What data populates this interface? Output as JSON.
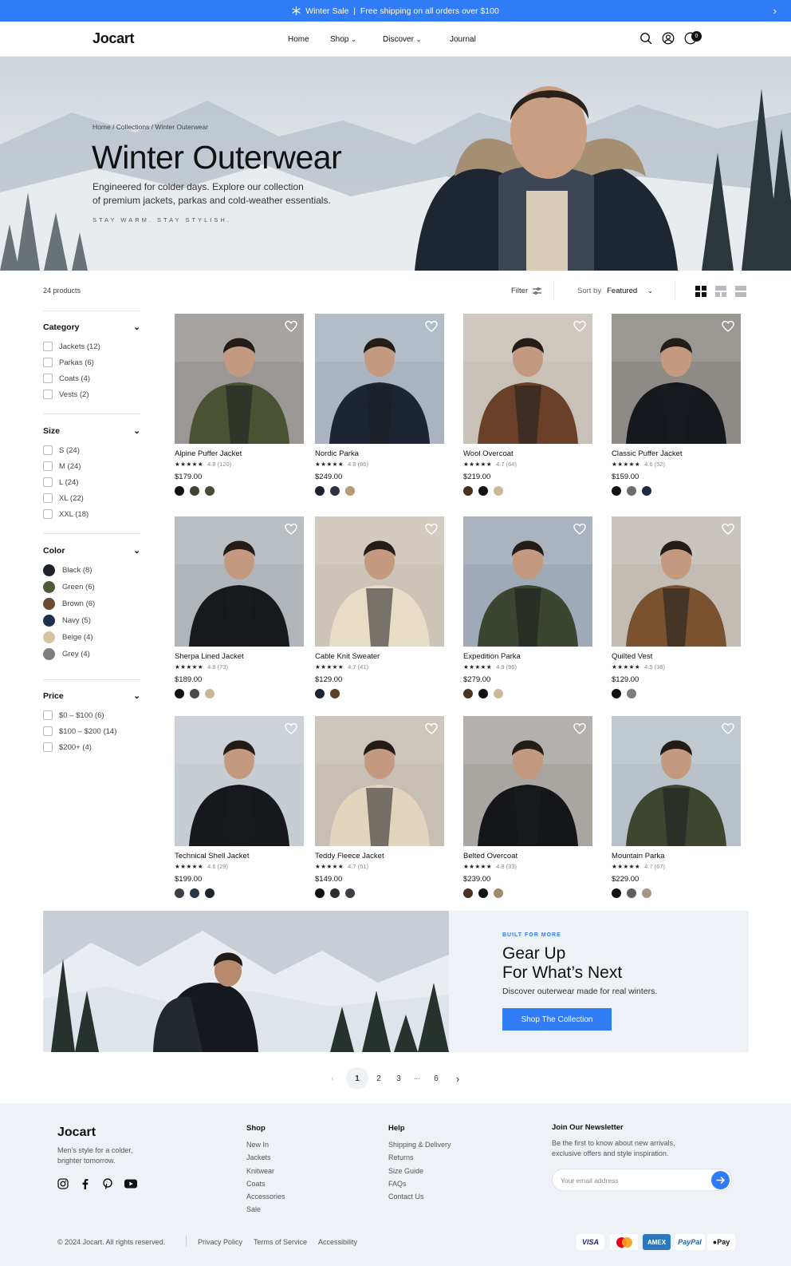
{
  "announcement": {
    "text": "Winter Sale  |  Free shipping on all orders over $100",
    "snow_icon": "snowflake-icon",
    "next_icon": "chevron-right-icon"
  },
  "header": {
    "logo": "Jocart",
    "nav": [
      {
        "label": "Home"
      },
      {
        "label": "Shop"
      },
      {
        "label": "Discover"
      },
      {
        "label": "Journal"
      }
    ],
    "cart_count": "0"
  },
  "hero": {
    "breadcrumb": [
      "Home",
      "Collections",
      "Winter Outerwear"
    ],
    "title": "Winter Outerwear",
    "description_1": "Engineered for colder days. Explore our collection",
    "description_2": "of premium jackets, parkas and cold-weather essentials.",
    "tagline": "STAY WARM. STAY STYLISH."
  },
  "toolbar": {
    "count": "24 products",
    "filter_label": "Filter",
    "sort_label": "Sort by",
    "sort_value": "Featured"
  },
  "filters": {
    "category": {
      "title": "Category",
      "options": [
        "Jackets (12)",
        "Parkas (6)",
        "Coats (4)",
        "Vests (2)"
      ]
    },
    "size": {
      "title": "Size",
      "options": [
        "S (24)",
        "M (24)",
        "L (24)",
        "XL (22)",
        "XXL (18)"
      ]
    },
    "color": {
      "title": "Color",
      "options": [
        {
          "label": "Black (8)",
          "hex": "#1e2329"
        },
        {
          "label": "Green (6)",
          "hex": "#4d5a3a"
        },
        {
          "label": "Brown (6)",
          "hex": "#6b4a30"
        },
        {
          "label": "Navy (5)",
          "hex": "#1f2f4e"
        },
        {
          "label": "Beige (4)",
          "hex": "#d7c3a2"
        },
        {
          "label": "Grey (4)",
          "hex": "#7b7d80"
        }
      ]
    },
    "price": {
      "title": "Price",
      "options": [
        "$0 – $100 (6)",
        "$100 – $200 (14)",
        "$200+ (4)"
      ]
    }
  },
  "products": [
    {
      "name": "Alpine Puffer Jacket",
      "rating": "4.8 (120)",
      "price": "$179.00",
      "jacket": "#4a5234",
      "bg": "#9a9795",
      "colors": [
        "#111",
        "#3e4530",
        "#4a4d30"
      ]
    },
    {
      "name": "Nordic Parka",
      "rating": "4.9 (86)",
      "price": "$249.00",
      "jacket": "#1d2532",
      "bg": "#a9b4c0",
      "colors": [
        "#1a2232",
        "#2b3342",
        "#b89a73"
      ]
    },
    {
      "name": "Wool Overcoat",
      "rating": "4.7 (64)",
      "price": "$219.00",
      "jacket": "#6a4128",
      "bg": "#c8c1b8",
      "colors": [
        "#4a3020",
        "#111",
        "#c8b89c"
      ]
    },
    {
      "name": "Classic Puffer Jacket",
      "rating": "4.6 (52)",
      "price": "$159.00",
      "jacket": "#15181d",
      "bg": "#8e8a85",
      "colors": [
        "#111",
        "#6c6c6c",
        "#1c2b45"
      ]
    },
    {
      "name": "Sherpa Lined Jacket",
      "rating": "4.8 (73)",
      "price": "$189.00",
      "jacket": "#17191c",
      "bg": "#b0b5ba",
      "colors": [
        "#111",
        "#4a4a4a",
        "#c8b59a"
      ]
    },
    {
      "name": "Cable Knit Sweater",
      "rating": "4.7 (41)",
      "price": "$129.00",
      "jacket": "#e7dcc5",
      "bg": "#cdc4b8",
      "colors": [
        "#1c2333",
        "#5a4028"
      ]
    },
    {
      "name": "Expedition Parka",
      "rating": "4.9 (96)",
      "price": "$279.00",
      "jacket": "#3b4530",
      "bg": "#9eaab7",
      "colors": [
        "#4a3322",
        "#111",
        "#c8b89c"
      ]
    },
    {
      "name": "Quilted Vest",
      "rating": "4.5 (38)",
      "price": "$129.00",
      "jacket": "#7a522f",
      "bg": "#c2bcb4",
      "colors": [
        "#111",
        "#7c7c7c"
      ]
    },
    {
      "name": "Technical Shell Jacket",
      "rating": "4.6 (29)",
      "price": "$199.00",
      "jacket": "#16181b",
      "bg": "#c5ccd2",
      "colors": [
        "#3b4048",
        "#2a3447",
        "#1d2535"
      ]
    },
    {
      "name": "Teddy Fleece Jacket",
      "rating": "4.7 (51)",
      "price": "$149.00",
      "jacket": "#e2d4bc",
      "bg": "#c7bfb3",
      "colors": [
        "#111",
        "#2d2d2d",
        "#3b3f45"
      ]
    },
    {
      "name": "Belted Overcoat",
      "rating": "4.8 (33)",
      "price": "$239.00",
      "jacket": "#14161a",
      "bg": "#a9a6a2",
      "colors": [
        "#4a3322",
        "#111",
        "#a08a6e"
      ]
    },
    {
      "name": "Mountain Parka",
      "rating": "4.7 (67)",
      "price": "$229.00",
      "jacket": "#3e4630",
      "bg": "#b8c1ca",
      "colors": [
        "#111",
        "#5d5f58",
        "#a49784"
      ]
    }
  ],
  "promo": {
    "tag": "BUILT FOR MORE",
    "title_1": "Gear Up",
    "title_2": "For What’s Next",
    "description": "Discover outerwear made for real winters.",
    "button": "Shop The Collection"
  },
  "pagination": {
    "pages": [
      "1",
      "2",
      "3",
      "···",
      "6"
    ],
    "current": "1"
  },
  "footer": {
    "logo": "Jocart",
    "tagline_1": "Men’s style for a colder,",
    "tagline_2": "brighter tomorrow.",
    "social": [
      "instagram-icon",
      "facebook-icon",
      "pinterest-icon",
      "youtube-icon"
    ],
    "shop": {
      "title": "Shop",
      "links": [
        "New In",
        "Jackets",
        "Knitwear",
        "Coats",
        "Accessories",
        "Sale"
      ]
    },
    "help": {
      "title": "Help",
      "links": [
        "Shipping & Delivery",
        "Returns",
        "Size Guide",
        "FAQs",
        "Contact Us"
      ]
    },
    "newsletter": {
      "title": "Join Our Newsletter",
      "text_1": "Be the first to know about new arrivals,",
      "text_2": "exclusive offers and style inspiration.",
      "placeholder": "Your email address"
    },
    "copyright": "© 2024 Jocart. All rights reserved.",
    "legal": [
      "Privacy Policy",
      "Terms of Service",
      "Accessibility"
    ],
    "payments": [
      "VISA",
      "Mastercard",
      "AMEX",
      "PayPal",
      "Pay"
    ]
  }
}
